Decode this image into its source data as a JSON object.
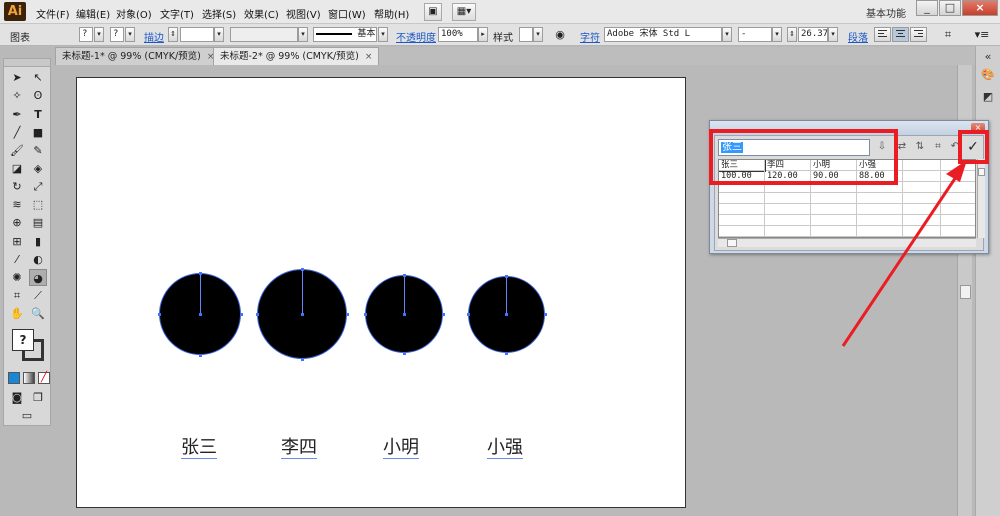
{
  "app": {
    "logo": "Ai",
    "workspace": "基本功能"
  },
  "menu": [
    "文件(F)",
    "编辑(E)",
    "对象(O)",
    "文字(T)",
    "选择(S)",
    "效果(C)",
    "视图(V)",
    "窗口(W)",
    "帮助(H)"
  ],
  "window_controls": {
    "minimize": "_",
    "maximize": "□",
    "close": "×"
  },
  "control_bar": {
    "object_type": "图表",
    "stroke_label": "描边",
    "stroke_style": "基本",
    "opacity_label": "不透明度",
    "opacity_value": "100%",
    "style_label": "样式",
    "char_label": "字符",
    "font_name": "Adobe 宋体 Std L",
    "font_style": "-",
    "font_size": "26.37",
    "para_label": "段落",
    "question_marks": [
      "?",
      "?"
    ]
  },
  "tabs": [
    {
      "label": "未标题-1* @ 99% (CMYK/预览)",
      "close": "×"
    },
    {
      "label": "未标题-2* @ 99% (CMYK/预览)",
      "close": "×"
    }
  ],
  "chart_data": {
    "type": "pie",
    "categories": [
      "张三",
      "李四",
      "小明",
      "小强"
    ],
    "values": [
      100,
      120,
      90,
      88
    ],
    "title": ""
  },
  "graph_data": {
    "input_value": "张三",
    "apply_icon": "✓",
    "headers": [
      "张三",
      "李四",
      "小明",
      "小强"
    ],
    "values": [
      "100.00",
      "120.00",
      "90.00",
      "88.00"
    ]
  },
  "colors": {
    "accent": "#ea1d22",
    "selection": "#3c64e0"
  }
}
